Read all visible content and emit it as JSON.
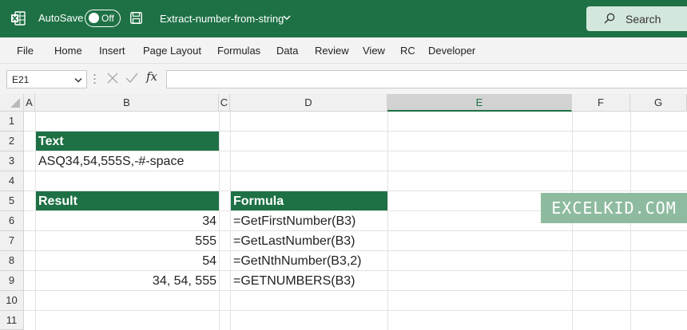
{
  "titlebar": {
    "autosave_label": "AutoSave",
    "autosave_state": "Off",
    "filename": "Extract-number-from-string",
    "search_label": "Search",
    "accent": "#1e7145"
  },
  "ribbon": {
    "tabs": [
      "File",
      "Home",
      "Insert",
      "Page Layout",
      "Formulas",
      "Data",
      "Review",
      "View",
      "RC",
      "Developer"
    ]
  },
  "formula_bar": {
    "name_box": "E21",
    "fx": "fx",
    "formula": ""
  },
  "sheet": {
    "columns": [
      "A",
      "B",
      "C",
      "D",
      "E",
      "F",
      "G"
    ],
    "selected_column": "E",
    "rows": [
      "1",
      "2",
      "3",
      "4",
      "5",
      "6",
      "7",
      "8",
      "9",
      "10",
      "11"
    ],
    "cells": {
      "B2": "Text",
      "B3": "ASQ34,54,555S,-#-space",
      "B5": "Result",
      "D5": "Formula",
      "B6": "34",
      "D6": "=GetFirstNumber(B3)",
      "B7": "555",
      "D7": "=GetLastNumber(B3)",
      "B8": "54",
      "D8": "=GetNthNumber(B3,2)",
      "B9": "34, 54, 555",
      "D9": "=GETNUMBERS(B3)"
    }
  },
  "watermark": "EXCELKID.COM"
}
